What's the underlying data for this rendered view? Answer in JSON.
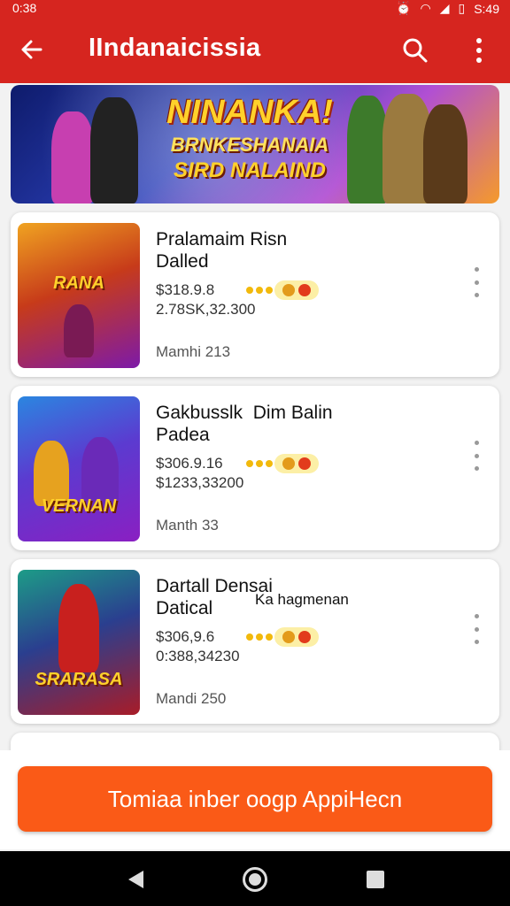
{
  "status": {
    "time": "0:38",
    "right_time": "S:49"
  },
  "appbar": {
    "title": "IIndanaicissia"
  },
  "banner": {
    "line1": "NINANKA!",
    "line2": "BRNKESHANAIA",
    "line3": "SIRD NALAIND"
  },
  "cards": [
    {
      "title": "Pralamaim Risn",
      "subtitle": "Dalled",
      "extra": "",
      "price": "$318.9.8",
      "downloads": "2.78SK,32.300",
      "date": "Mamhi 213",
      "thumb_text": "RANA",
      "thumb_colors": [
        "#f0a321",
        "#7d1aa8"
      ]
    },
    {
      "title": "Gakbusslk  Dim Balin",
      "subtitle": "Padea",
      "extra": "",
      "price": "$306.9.16",
      "downloads": "$1233,33200",
      "date": "Manth 33",
      "thumb_text": "VERNAN",
      "thumb_colors": [
        "#2b86e0",
        "#8a1fc2"
      ]
    },
    {
      "title": "Dartall Densai",
      "subtitle": "Datical",
      "extra": "Ka hagmenan",
      "price": "$306,9.6",
      "downloads": "0:388,34230",
      "date": "Mandi 250",
      "thumb_text": "SRARASA",
      "thumb_colors": [
        "#1d9c87",
        "#a81c28"
      ]
    }
  ],
  "cta": {
    "label": "Tomiaa inber oogp AppiHecn"
  }
}
